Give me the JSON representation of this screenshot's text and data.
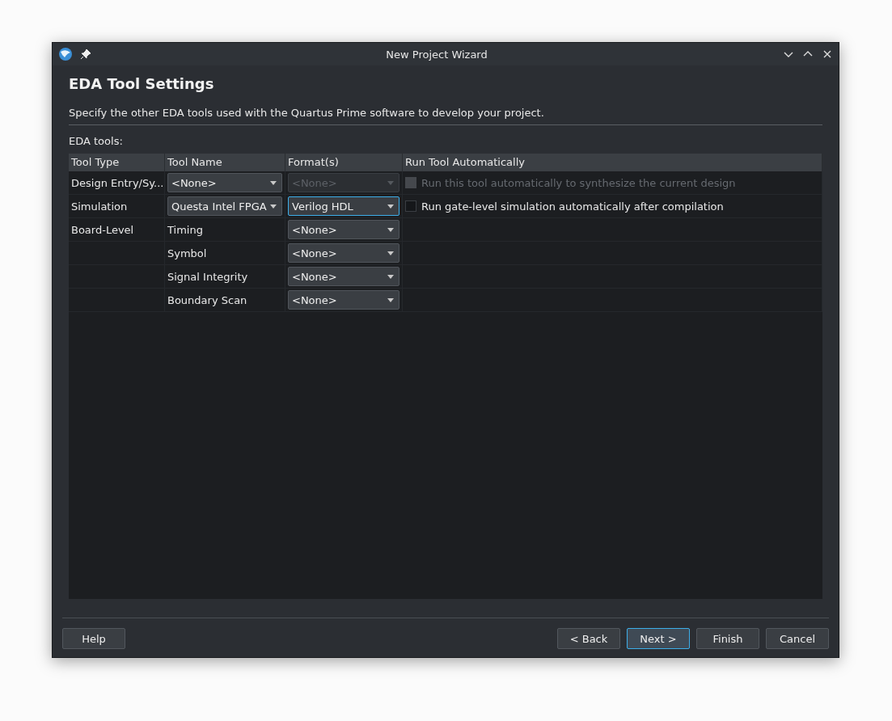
{
  "window": {
    "title": "New Project Wizard"
  },
  "page": {
    "heading": "EDA Tool Settings",
    "description": "Specify the other EDA tools used with the Quartus Prime software to develop your project.",
    "section_label": "EDA tools:"
  },
  "table": {
    "columns": [
      "Tool Type",
      "Tool Name",
      "Format(s)",
      "Run Tool Automatically"
    ],
    "rows": [
      {
        "tool_type": "Design Entry/Sy...",
        "tool_name": {
          "kind": "combo",
          "value": "<None>"
        },
        "format": {
          "value": "<None>",
          "disabled": true,
          "focused": false
        },
        "run": {
          "label": "Run this tool automatically to synthesize the current design",
          "checked": false,
          "disabled": true
        }
      },
      {
        "tool_type": "Simulation",
        "tool_name": {
          "kind": "combo",
          "value": "Questa Intel FPGA"
        },
        "format": {
          "value": "Verilog HDL",
          "disabled": false,
          "focused": true
        },
        "run": {
          "label": "Run gate-level simulation automatically after compilation",
          "checked": false,
          "disabled": false
        }
      },
      {
        "tool_type": "Board-Level",
        "tool_name": {
          "kind": "text",
          "value": "Timing"
        },
        "format": {
          "value": "<None>",
          "disabled": false,
          "focused": false
        }
      },
      {
        "tool_name": {
          "kind": "text",
          "value": "Symbol"
        },
        "format": {
          "value": "<None>",
          "disabled": false,
          "focused": false
        }
      },
      {
        "tool_name": {
          "kind": "text",
          "value": "Signal Integrity"
        },
        "format": {
          "value": "<None>",
          "disabled": false,
          "focused": false
        }
      },
      {
        "tool_name": {
          "kind": "text",
          "value": "Boundary Scan"
        },
        "format": {
          "value": "<None>",
          "disabled": false,
          "focused": false
        }
      }
    ]
  },
  "buttons": [
    {
      "label": "Help",
      "kind": "left",
      "focused": false
    },
    {
      "label": "< Back",
      "kind": "right",
      "focused": false
    },
    {
      "label": "Next >",
      "kind": "right",
      "focused": true
    },
    {
      "label": "Finish",
      "kind": "right",
      "focused": false
    },
    {
      "label": "Cancel",
      "kind": "right",
      "focused": false
    }
  ]
}
